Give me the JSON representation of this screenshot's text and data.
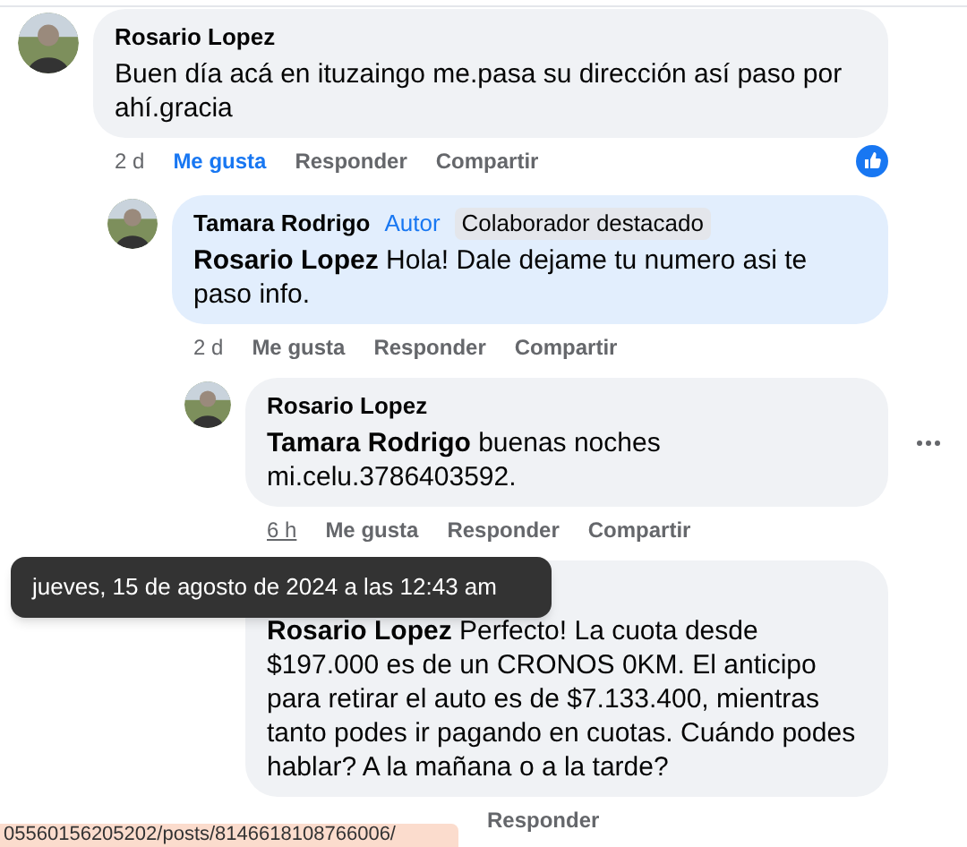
{
  "comments": [
    {
      "author": "Rosario Lopez",
      "highlighted": false,
      "text": "Buen día acá en ituzaingo me.pasa su dirección así paso por ahí.gracia",
      "time": "2 d",
      "time_hovered": false,
      "reacted": true,
      "more": false,
      "actions": [
        {
          "label": "Me gusta",
          "selected": true
        },
        {
          "label": "Responder",
          "selected": false
        },
        {
          "label": "Compartir",
          "selected": false
        }
      ],
      "children": [
        {
          "author": "Tamara Rodrigo",
          "highlighted": true,
          "badges": [
            {
              "label": "Autor",
              "kind": "role"
            },
            {
              "label": "Colaborador destacado",
              "kind": "tag"
            }
          ],
          "mention": "Rosario Lopez",
          "text": "Hola! Dale dejame tu numero asi te paso info.",
          "time": "2 d",
          "time_hovered": false,
          "reacted": false,
          "more": false,
          "actions": [
            {
              "label": "Me gusta",
              "selected": false
            },
            {
              "label": "Responder",
              "selected": false
            },
            {
              "label": "Compartir",
              "selected": false
            }
          ],
          "children": [
            {
              "author": "Rosario Lopez",
              "highlighted": false,
              "mention": "Tamara Rodrigo",
              "text": "buenas noches mi.celu.3786403592.",
              "time": "6 h",
              "time_hovered": true,
              "reacted": false,
              "more": true,
              "actions": [
                {
                  "label": "Me gusta",
                  "selected": false
                },
                {
                  "label": "Responder",
                  "selected": false
                },
                {
                  "label": "Compartir",
                  "selected": false
                }
              ]
            },
            {
              "highlighted": false,
              "mention": "Rosario Lopez",
              "text": "Perfecto! La cuota desde $197.000 es de un CRONOS 0KM. El anticipo para retirar el auto es de $7.133.400, mientras tanto podes ir pagando en cuotas. Cuándo podes hablar? A la mañana o a la tarde?",
              "reacted": false,
              "more": false,
              "actions": [
                {
                  "label": "Responder",
                  "selected": false
                }
              ]
            }
          ]
        }
      ]
    }
  ],
  "tooltip": "jueves, 15 de agosto de 2024 a las 12:43 am",
  "status_url": "05560156205202/posts/8146618108766006/"
}
